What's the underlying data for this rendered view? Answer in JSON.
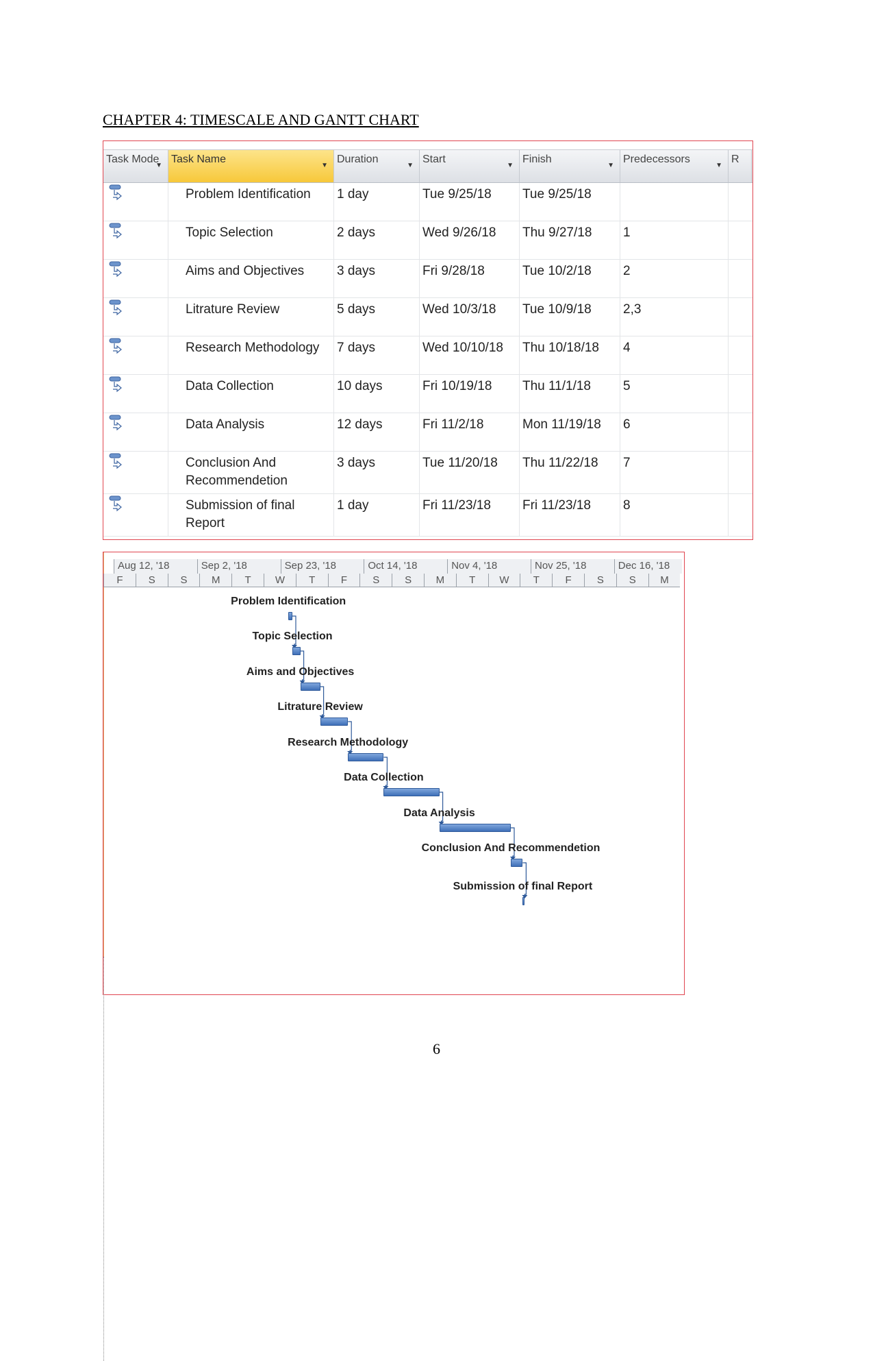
{
  "heading": "CHAPTER 4: TIMESCALE AND GANTT CHART",
  "page_number": "6",
  "table": {
    "columns": [
      "Task Mode",
      "Task Name",
      "Duration",
      "Start",
      "Finish",
      "Predecessors",
      "R"
    ],
    "rows": [
      {
        "name": "Problem Identification",
        "duration": "1 day",
        "start": "Tue 9/25/18",
        "finish": "Tue 9/25/18",
        "pred": ""
      },
      {
        "name": "Topic Selection",
        "duration": "2 days",
        "start": "Wed 9/26/18",
        "finish": "Thu 9/27/18",
        "pred": "1"
      },
      {
        "name": "Aims and Objectives",
        "duration": "3 days",
        "start": "Fri 9/28/18",
        "finish": "Tue 10/2/18",
        "pred": "2"
      },
      {
        "name": "Litrature Review",
        "duration": "5 days",
        "start": "Wed 10/3/18",
        "finish": "Tue 10/9/18",
        "pred": "2,3"
      },
      {
        "name": "Research Methodology",
        "duration": "7 days",
        "start": "Wed 10/10/18",
        "finish": "Thu 10/18/18",
        "pred": "4"
      },
      {
        "name": "Data Collection",
        "duration": "10 days",
        "start": "Fri 10/19/18",
        "finish": "Thu 11/1/18",
        "pred": "5"
      },
      {
        "name": "Data Analysis",
        "duration": "12 days",
        "start": "Fri 11/2/18",
        "finish": "Mon 11/19/18",
        "pred": "6"
      },
      {
        "name": "Conclusion And Recommendetion",
        "duration": "3 days",
        "start": "Tue 11/20/18",
        "finish": "Thu 11/22/18",
        "pred": "7"
      },
      {
        "name": "Submission of final Report",
        "duration": "1 day",
        "start": "Fri 11/23/18",
        "finish": "Fri 11/23/18",
        "pred": "8"
      }
    ]
  },
  "gantt": {
    "major": [
      "Aug 12, '18",
      "Sep 2, '18",
      "Sep 23, '18",
      "Oct 14, '18",
      "Nov 4, '18",
      "Nov 25, '18",
      "Dec 16, '18"
    ],
    "minor": [
      "F",
      "S",
      "S",
      "M",
      "T",
      "W",
      "T",
      "F",
      "S",
      "S",
      "M",
      "T",
      "W",
      "T",
      "F",
      "S",
      "S",
      "M"
    ],
    "bar_color": "#4a7cc4",
    "today_line_color": "#e0b070",
    "tasks": [
      {
        "label": "Problem Identification",
        "start": "2018-09-25",
        "end": "2018-09-26"
      },
      {
        "label": "Topic Selection",
        "start": "2018-09-26",
        "end": "2018-09-28"
      },
      {
        "label": "Aims and Objectives",
        "start": "2018-09-28",
        "end": "2018-10-03"
      },
      {
        "label": "Litrature Review",
        "start": "2018-10-03",
        "end": "2018-10-10"
      },
      {
        "label": "Research Methodology",
        "start": "2018-10-10",
        "end": "2018-10-19"
      },
      {
        "label": "Data Collection",
        "start": "2018-10-19",
        "end": "2018-11-02"
      },
      {
        "label": "Data Analysis",
        "start": "2018-11-02",
        "end": "2018-11-20"
      },
      {
        "label": "Conclusion And Recommendetion",
        "start": "2018-11-20",
        "end": "2018-11-23"
      },
      {
        "label": "Submission of final Report",
        "start": "2018-11-23",
        "end": "2018-11-23"
      }
    ]
  }
}
